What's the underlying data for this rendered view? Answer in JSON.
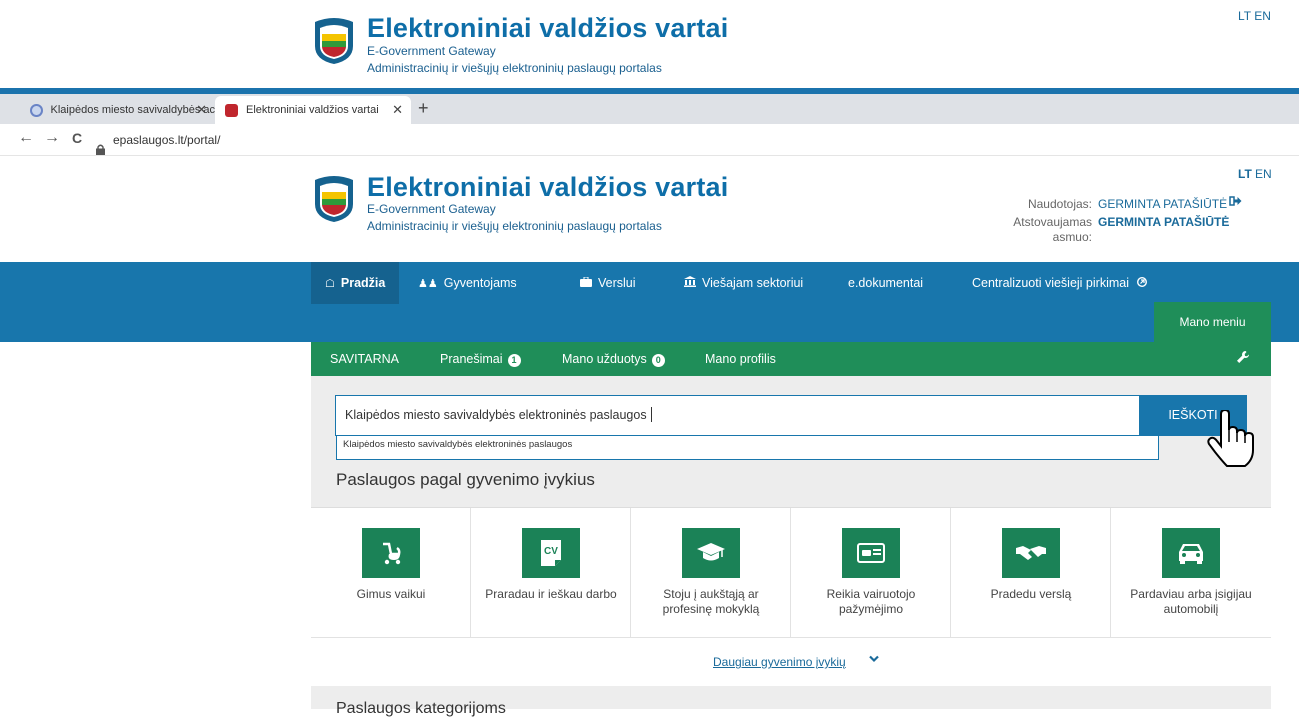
{
  "top_header": {
    "title": "Elektroniniai valdžios vartai",
    "subtitle1": "E-Government Gateway",
    "subtitle2": "Administracinių ir viešųjų elektroninių paslaugų portalas",
    "lang": "LT EN"
  },
  "browser": {
    "tabs": [
      {
        "label": "Klaipėdos miesto savivaldybės ac",
        "close": "✕",
        "active": false
      },
      {
        "label": "Elektroniniai valdžios vartai",
        "close": "✕",
        "active": true
      }
    ],
    "new_tab": "+",
    "back": "←",
    "forward": "→",
    "reload": "C",
    "url": "epaslaugos.lt/portal/"
  },
  "portal_header": {
    "title": "Elektroniniai valdžios vartai",
    "subtitle1": "E-Government Gateway",
    "subtitle2": "Administracinių ir viešųjų elektroninių paslaugų portalas",
    "lang_lt": "LT",
    "lang_en": "EN",
    "user_label": "Naudotojas:",
    "user_name": "GERMINTA PATAŠIŪTĖ",
    "rep_label_1": "Atstovaujamas",
    "rep_label_2": "asmuo:",
    "rep_name": "GERMINTA PATAŠIŪTĖ"
  },
  "main_nav": {
    "items": [
      {
        "label": "Pradžia",
        "icon": "home-icon",
        "active": true
      },
      {
        "label": "Gyventojams",
        "icon": "users-icon",
        "active": false
      },
      {
        "label": "Verslui",
        "icon": "briefcase-icon",
        "active": false
      },
      {
        "label": "Viešajam sektoriui",
        "icon": "institution-icon",
        "active": false
      },
      {
        "label": "e.dokumentai",
        "icon": "",
        "active": false
      },
      {
        "label": "Centralizuoti viešieji pirkimai",
        "icon": "external-link-icon",
        "active": false
      }
    ],
    "my_menu": "Mano meniu"
  },
  "sub_nav": {
    "items": [
      {
        "label": "SAVITARNA"
      },
      {
        "label": "Pranešimai",
        "badge": "1"
      },
      {
        "label": "Mano užduotys",
        "badge": "0"
      },
      {
        "label": "Mano profilis"
      }
    ]
  },
  "search": {
    "value": "Klaipėdos miesto savivaldybės elektroninės paslaugos",
    "button": "IEŠKOTI",
    "suggestion": "Klaipėdos miesto savivaldybės elektroninės paslaugos"
  },
  "life_events": {
    "title": "Paslaugos pagal gyvenimo įvykius",
    "items": [
      {
        "label": "Gimus vaikui",
        "icon": "stroller-icon"
      },
      {
        "label": "Praradau ir ieškau darbo",
        "icon": "cv-icon"
      },
      {
        "label": "Stoju į aukštąją ar profesinę mokyklą",
        "icon": "graduation-cap-icon"
      },
      {
        "label": "Reikia vairuotojo pažymėjimo",
        "icon": "driver-license-icon"
      },
      {
        "label": "Pradedu verslą",
        "icon": "handshake-icon"
      },
      {
        "label": "Pardaviau arba įsigijau automobilį",
        "icon": "car-icon"
      }
    ],
    "more": "Daugiau gyvenimo įvykių",
    "next_heading": "Paslaugos kategorijoms"
  },
  "colors": {
    "brand_blue": "#1876ac",
    "brand_green": "#1f8e59",
    "icon_green": "#1b8257"
  }
}
